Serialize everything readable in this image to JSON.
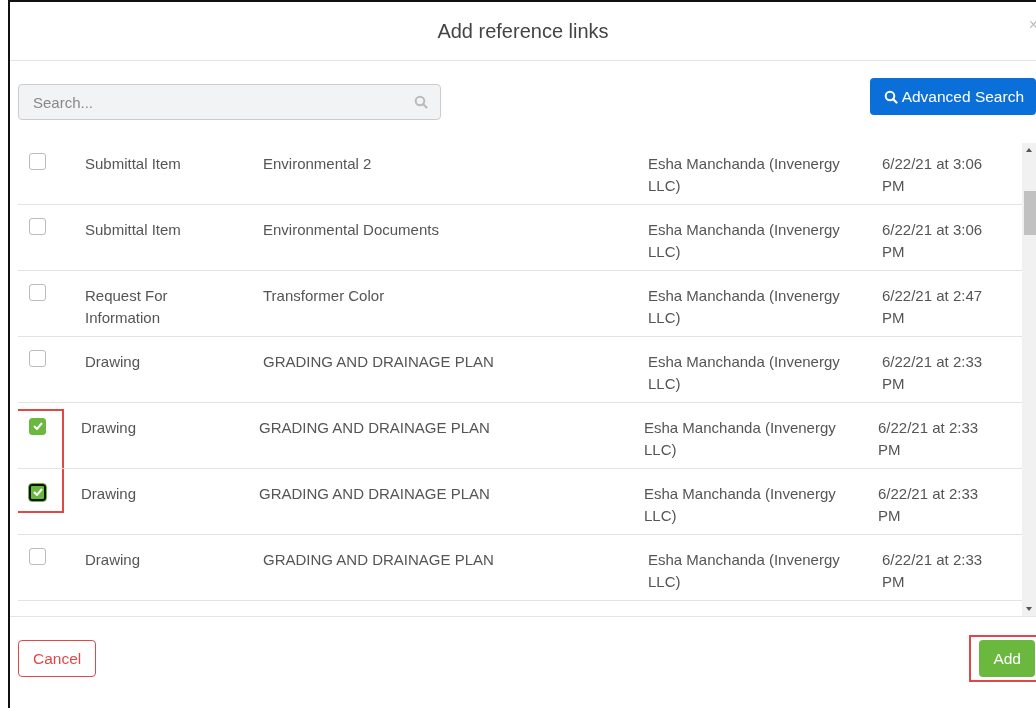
{
  "dialog": {
    "title": "Add reference links",
    "close": "×"
  },
  "search": {
    "placeholder": "Search..."
  },
  "advanced_search": {
    "label": "Advanced Search"
  },
  "rows": [
    {
      "type": "Submittal Item",
      "title": "Environmental 2",
      "creator": "Esha Manchanda (Invenergy LLC)",
      "date": "6/22/21 at 3:06 PM",
      "checked": false,
      "focused": false,
      "highlighted": false
    },
    {
      "type": "Submittal Item",
      "title": "Environmental Documents",
      "creator": "Esha Manchanda (Invenergy LLC)",
      "date": "6/22/21 at 3:06 PM",
      "checked": false,
      "focused": false,
      "highlighted": false
    },
    {
      "type": "Request For Information",
      "title": "Transformer Color",
      "creator": "Esha Manchanda (Invenergy LLC)",
      "date": "6/22/21 at 2:47 PM",
      "checked": false,
      "focused": false,
      "highlighted": false
    },
    {
      "type": "Drawing",
      "title": "GRADING AND DRAINAGE PLAN",
      "creator": "Esha Manchanda (Invenergy LLC)",
      "date": "6/22/21 at 2:33 PM",
      "checked": false,
      "focused": false,
      "highlighted": false
    },
    {
      "type": "Drawing",
      "title": "GRADING AND DRAINAGE PLAN",
      "creator": "Esha Manchanda (Invenergy LLC)",
      "date": "6/22/21 at 2:33 PM",
      "checked": true,
      "focused": false,
      "highlighted": true
    },
    {
      "type": "Drawing",
      "title": "GRADING AND DRAINAGE PLAN",
      "creator": "Esha Manchanda (Invenergy LLC)",
      "date": "6/22/21 at 2:33 PM",
      "checked": true,
      "focused": true,
      "highlighted": true
    },
    {
      "type": "Drawing",
      "title": "GRADING AND DRAINAGE PLAN",
      "creator": "Esha Manchanda (Invenergy LLC)",
      "date": "6/22/21 at 2:33 PM",
      "checked": false,
      "focused": false,
      "highlighted": false
    }
  ],
  "footer": {
    "cancel": {
      "label": "Cancel"
    },
    "add": {
      "label": "Add",
      "highlighted": true
    }
  }
}
